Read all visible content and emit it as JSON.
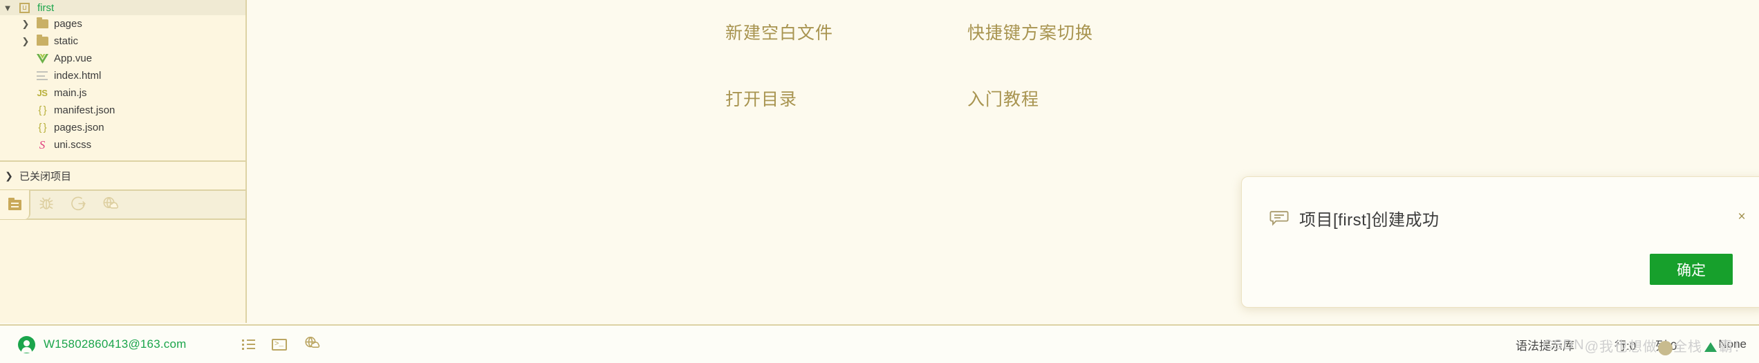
{
  "sidebar": {
    "project": {
      "name": "first",
      "icon": "uni-badge-icon",
      "expanded": true
    },
    "tree": [
      {
        "label": "pages",
        "icon": "folder-icon",
        "expandable": true,
        "indent": 1
      },
      {
        "label": "static",
        "icon": "folder-icon",
        "expandable": true,
        "indent": 1
      },
      {
        "label": "App.vue",
        "icon": "vue-icon",
        "expandable": false,
        "indent": 1
      },
      {
        "label": "index.html",
        "icon": "html-icon",
        "expandable": false,
        "indent": 1
      },
      {
        "label": "main.js",
        "icon": "js-icon",
        "expandable": false,
        "indent": 1
      },
      {
        "label": "manifest.json",
        "icon": "json-icon",
        "expandable": false,
        "indent": 1
      },
      {
        "label": "pages.json",
        "icon": "json-icon",
        "expandable": false,
        "indent": 1
      },
      {
        "label": "uni.scss",
        "icon": "sass-icon",
        "expandable": false,
        "indent": 1
      }
    ],
    "closed_projects": {
      "label": "已关闭项目",
      "expanded": false
    },
    "tabstrip": {
      "active": "project-manager-icon",
      "tools": [
        "bug-icon",
        "terminal-share-icon",
        "globe-cloud-icon"
      ]
    }
  },
  "welcome": {
    "items": [
      {
        "label": "新建空白文件"
      },
      {
        "label": "快捷键方案切换"
      },
      {
        "label": "打开目录"
      },
      {
        "label": "入门教程"
      }
    ]
  },
  "dialog": {
    "icon": "message-bubble-icon",
    "title": "项目[first]创建成功",
    "confirm_label": "确定",
    "close_label": "×",
    "accent_color": "#17a02c"
  },
  "statusbar": {
    "account": {
      "email": "W15802860413@163.com",
      "color": "#1ba54b"
    },
    "icons": [
      "list-icon",
      "terminal-icon",
      "globe-cloud-icon"
    ],
    "right": {
      "syntax_hint": "语法提示库",
      "line_label": "行:0",
      "column_label": "列:0",
      "encoding": "None"
    }
  },
  "watermark": {
    "prefix": "CSDN",
    "text_a": "@我也想做",
    "text_b": "全栈",
    "text_c": "霸！"
  }
}
